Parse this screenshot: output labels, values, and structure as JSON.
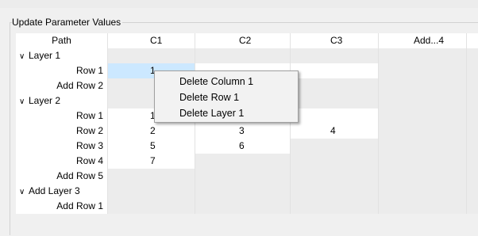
{
  "group_title": "Update Parameter Values",
  "columns": [
    "Path",
    "C1",
    "C2",
    "C3",
    "Add...4"
  ],
  "rows": [
    {
      "kind": "group",
      "path": "Layer 1",
      "cells": [
        "",
        "",
        "",
        ""
      ]
    },
    {
      "kind": "row",
      "path": "Row 1",
      "cells": [
        "1",
        "",
        "",
        ""
      ],
      "selected": 0
    },
    {
      "kind": "add",
      "path": "Add Row 2",
      "cells": [
        "",
        "",
        "",
        ""
      ]
    },
    {
      "kind": "group",
      "path": "Layer 2",
      "cells": [
        "",
        "",
        "",
        ""
      ]
    },
    {
      "kind": "row",
      "path": "Row 1",
      "cells": [
        "1",
        "",
        "",
        ""
      ]
    },
    {
      "kind": "row",
      "path": "Row 2",
      "cells": [
        "2",
        "3",
        "4",
        ""
      ]
    },
    {
      "kind": "row",
      "path": "Row 3",
      "cells": [
        "5",
        "6",
        "",
        ""
      ]
    },
    {
      "kind": "row",
      "path": "Row 4",
      "cells": [
        "7",
        "",
        "",
        ""
      ]
    },
    {
      "kind": "add",
      "path": "Add Row 5",
      "cells": [
        "",
        "",
        "",
        ""
      ]
    },
    {
      "kind": "group",
      "path": "Add Layer 3",
      "cells": [
        "",
        "",
        "",
        ""
      ]
    },
    {
      "kind": "add",
      "path": "Add Row 1",
      "cells": [
        "",
        "",
        "",
        ""
      ]
    }
  ],
  "context_menu": [
    "Delete Column 1",
    "Delete Row 1",
    "Delete Layer 1"
  ],
  "colors": {
    "selected": "#cce8ff",
    "editable": "#ffffff",
    "empty": "#ececec"
  }
}
